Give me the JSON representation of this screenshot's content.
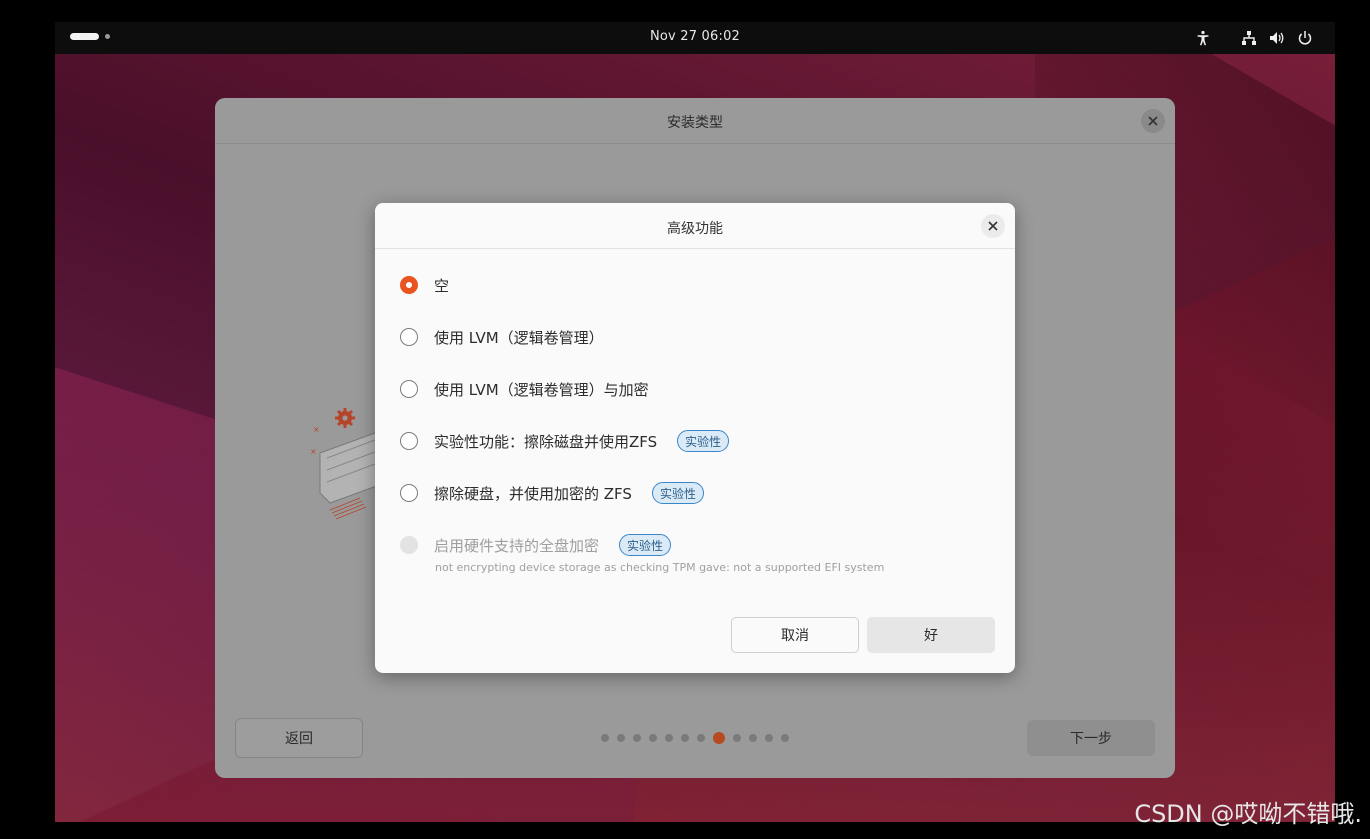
{
  "topbar": {
    "clock": "Nov 27  06:02",
    "tray_icons": [
      "accessibility-icon",
      "network-icon",
      "volume-icon",
      "power-icon"
    ]
  },
  "installer": {
    "title": "安装类型",
    "back_label": "返回",
    "next_label": "下一步",
    "progress": {
      "total_steps": 12,
      "current_step": 8
    }
  },
  "dialog": {
    "title": "高级功能",
    "options": [
      {
        "label": "空",
        "selected": true,
        "enabled": true
      },
      {
        "label": "使用 LVM（逻辑卷管理）",
        "selected": false,
        "enabled": true
      },
      {
        "label": "使用 LVM（逻辑卷管理）与加密",
        "selected": false,
        "enabled": true
      },
      {
        "label": "实验性功能：擦除磁盘并使用ZFS",
        "selected": false,
        "enabled": true,
        "badge": "实验性"
      },
      {
        "label": "擦除硬盘，并使用加密的 ZFS",
        "selected": false,
        "enabled": true,
        "badge": "实验性"
      },
      {
        "label": "启用硬件支持的全盘加密",
        "selected": false,
        "enabled": false,
        "badge": "实验性"
      }
    ],
    "tpm_note": "not encrypting device storage as checking TPM gave: not a supported EFI system",
    "cancel_label": "取消",
    "ok_label": "好"
  },
  "watermark": "CSDN @哎呦不错哦."
}
